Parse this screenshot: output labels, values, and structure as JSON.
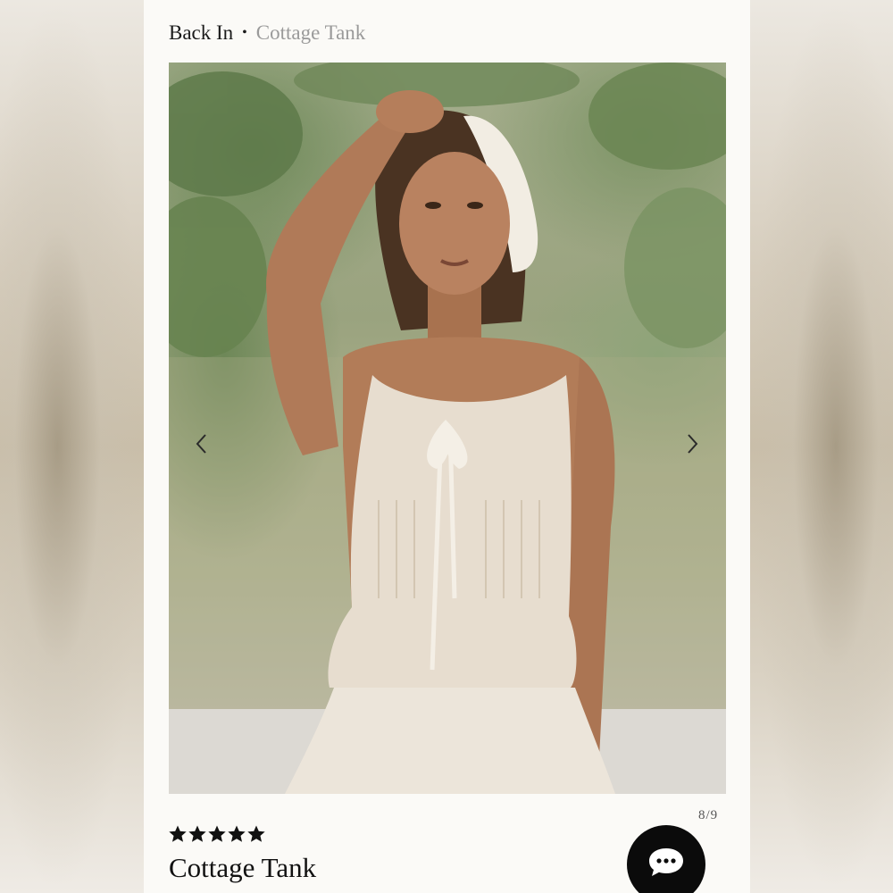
{
  "breadcrumb": {
    "parent": "Back In",
    "separator": "•",
    "current": "Cottage Tank"
  },
  "gallery": {
    "counter": "8/9",
    "prev_icon": "chevron-left-icon",
    "next_icon": "chevron-right-icon"
  },
  "product": {
    "rating": 5,
    "rating_max": 5,
    "title": "Cottage Tank"
  },
  "chat": {
    "icon": "chat-bubble-icon"
  },
  "colors": {
    "text": "#1a1a1a",
    "muted": "#9a9a9a",
    "page_background": "#fbfaf7",
    "chat_button": "#0b0b0b"
  }
}
